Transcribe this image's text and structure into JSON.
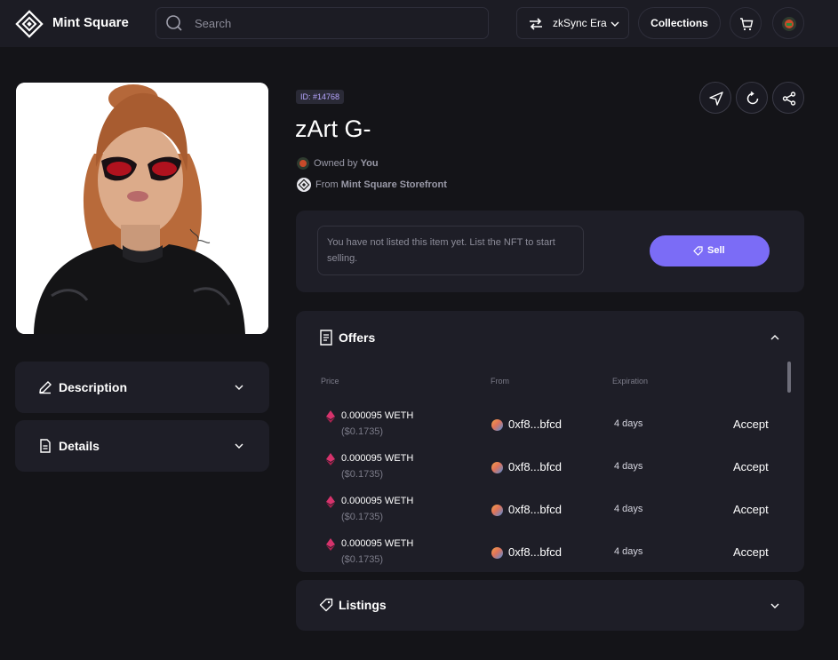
{
  "header": {
    "brand": "Mint Square",
    "search_placeholder": "Search",
    "network": "zkSync Era",
    "collections_label": "Collections",
    "icons": [
      "logo-icon",
      "search-icon",
      "swap-icon",
      "chevron-down-icon",
      "cart-icon",
      "avatar-icon"
    ]
  },
  "item": {
    "id_label": "ID: #14768",
    "title": "zArt G-",
    "owned_prefix": "Owned by",
    "owner": "You",
    "from_prefix": "From",
    "collection": "Mint Square Storefront",
    "actions": [
      "send-icon",
      "refresh-icon",
      "share-icon"
    ]
  },
  "sell": {
    "note": "You have not listed this item yet. List the NFT to start selling.",
    "button": "Sell"
  },
  "left_panels": {
    "description": "Description",
    "details": "Details"
  },
  "offers": {
    "title": "Offers",
    "columns": [
      "Price",
      "From",
      "Expiration"
    ],
    "rows": [
      {
        "price": "0.000095 WETH",
        "usd": "($0.1735)",
        "from": "0xf8...bfcd",
        "expiration": "4 days",
        "action": "Accept"
      },
      {
        "price": "0.000095 WETH",
        "usd": "($0.1735)",
        "from": "0xf8...bfcd",
        "expiration": "4 days",
        "action": "Accept"
      },
      {
        "price": "0.000095 WETH",
        "usd": "($0.1735)",
        "from": "0xf8...bfcd",
        "expiration": "4 days",
        "action": "Accept"
      },
      {
        "price": "0.000095 WETH",
        "usd": "($0.1735)",
        "from": "0xf8...bfcd",
        "expiration": "4 days",
        "action": "Accept"
      }
    ]
  },
  "listings": {
    "title": "Listings"
  },
  "colors": {
    "background": "#141418",
    "panel": "#1e1e27",
    "accent": "#7b6cf6",
    "eth": "#d6336c"
  }
}
